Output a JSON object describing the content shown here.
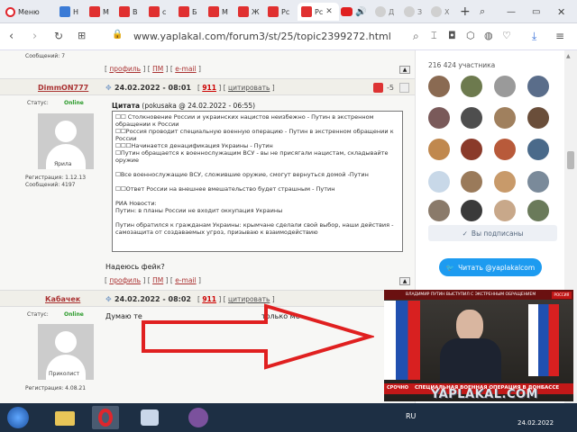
{
  "tabs": [
    {
      "label": "Меню",
      "color": "#e03030"
    },
    {
      "label": "Н",
      "color": "#3b7bd6"
    },
    {
      "label": "М",
      "color": "#e03030"
    },
    {
      "label": "В",
      "color": "#e03030"
    },
    {
      "label": "с",
      "color": "#e03030"
    },
    {
      "label": "Б",
      "color": "#e03030"
    },
    {
      "label": "М",
      "color": "#e03030"
    },
    {
      "label": "Ж",
      "color": "#e03030"
    },
    {
      "label": "Рс",
      "color": "#e03030"
    },
    {
      "label": "Д",
      "color": "#d0d0d0"
    },
    {
      "label": "З",
      "color": "#d0d0d0"
    },
    {
      "label": "Х",
      "color": "#d0d0d0"
    }
  ],
  "address_bar": {
    "url": "www.yaplakal.com/forum3/st/25/topic2399272.html"
  },
  "prev_post": {
    "stats": "Сообщений: 7",
    "links": [
      "профиль",
      "ПМ",
      "e-mail"
    ]
  },
  "post1": {
    "author": "DimmON777",
    "date": "24.02.2022 - 08:01",
    "rating": "911",
    "quote_link": "цитировать",
    "score": "-5",
    "status_label": "Статус:",
    "status": "Online",
    "rank": "Ярила",
    "reg": "Регистрация: 1.12.13",
    "messages": "Сообщений: 4197",
    "quote_header_bold": "Цитата",
    "quote_header_rest": " (pokusaka @ 24.02.2022 - 06:55)",
    "quote_lines": [
      "☐☐ Столкновение России и украинских нацистов неизбежно - Путин в экстренном обращении к России",
      "☐☐Россия проводит специальную военную операцию - Путин в экстренном обращении к России",
      "☐☐☐Начинается денацификация Украины - Путин",
      "☐Путин обращается к военнослужащим ВСУ - вы не присягали нацистам, складывайте оружие",
      "",
      "☐Все военнослужащие ВСУ, сложившие оружие, смогут вернуться домой -Путин",
      "",
      "☐☐Ответ России на внешнее вмешательство будет страшным - Путин",
      "",
      "РИА Новости:",
      "Путин: в планы России не входит оккупация Украины",
      "",
      "Путин обратился к гражданам Украины: крымчане сделали свой выбор, наши действия - самозащита от создаваемых угроз, призываю к взаимодействию"
    ],
    "reply": "Надеюсь фейк?",
    "links": [
      "профиль",
      "ПМ",
      "e-mail"
    ]
  },
  "post2": {
    "author": "Кабачек",
    "date": "24.02.2022 - 08:02",
    "rating": "911",
    "quote_link": "цитировать",
    "status_label": "Статус:",
    "status": "Online",
    "rank": "Приколист",
    "reg": "Регистрация: 4.08.21",
    "text_start": "Думаю те",
    "text_end": "только ме"
  },
  "sidebar": {
    "members": "216 424 участника",
    "subscribed": "Вы подписаны",
    "twitter": "Читать @yaplakalcom"
  },
  "video": {
    "top_text": "ВЛАДИМИР ПУТИН ВЫСТУПИЛ С ЭКСТРЕННЫМ ОБРАЩЕНИЕМ",
    "bottom_tag": "СРОЧНО",
    "bottom_text": "СПЕЦИАЛЬНАЯ ВОЕННАЯ ОПЕРАЦИЯ В ДОНБАССЕ",
    "channel": "РОССИЯ 24"
  },
  "watermark": "YAPLAKAL.COM",
  "taskbar": {
    "lang": "RU",
    "date": "24.02.2022"
  }
}
